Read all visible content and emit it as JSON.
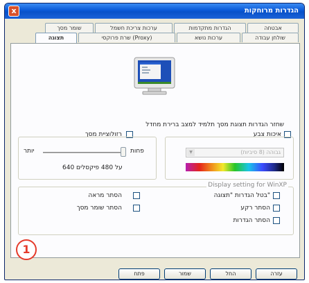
{
  "window": {
    "title": "הגדרות מרוחקות",
    "close_label": "x"
  },
  "tabs_row1": [
    "אבטחה",
    "הגדרות מתקדמות",
    "ערכות צריכת חשמל",
    "שומר מסך"
  ],
  "tabs_row2": [
    "שולחן עבודה",
    "ערכות נושא",
    "שרת פרוקסי (Proxy)",
    "תצוגה"
  ],
  "active_tab": "תצוגה",
  "description": "שחזר הגדרות תצוגת מסך תלמיד למצב ברירת מחדל",
  "color": {
    "checkbox_label": "איכות צבע",
    "select_value": "גבוהה (8 סיביות)"
  },
  "resolution": {
    "checkbox_label": "רזולוציית מסך",
    "less": "פחות",
    "more": "יותר",
    "value_text": "640 על 480 פיקסלים"
  },
  "winxp": {
    "heading": "Display setting for WinXP",
    "options": [
      "בטל הגדרות \"תצוגה\"",
      "הסתר רקע",
      "הסתר הגדרות",
      "הסתר מראה",
      "הסתר שומר מסך"
    ]
  },
  "buttons": {
    "help": "עזרה",
    "apply": "החל",
    "save": "שמור",
    "open": "פתח"
  },
  "annotation": "1"
}
